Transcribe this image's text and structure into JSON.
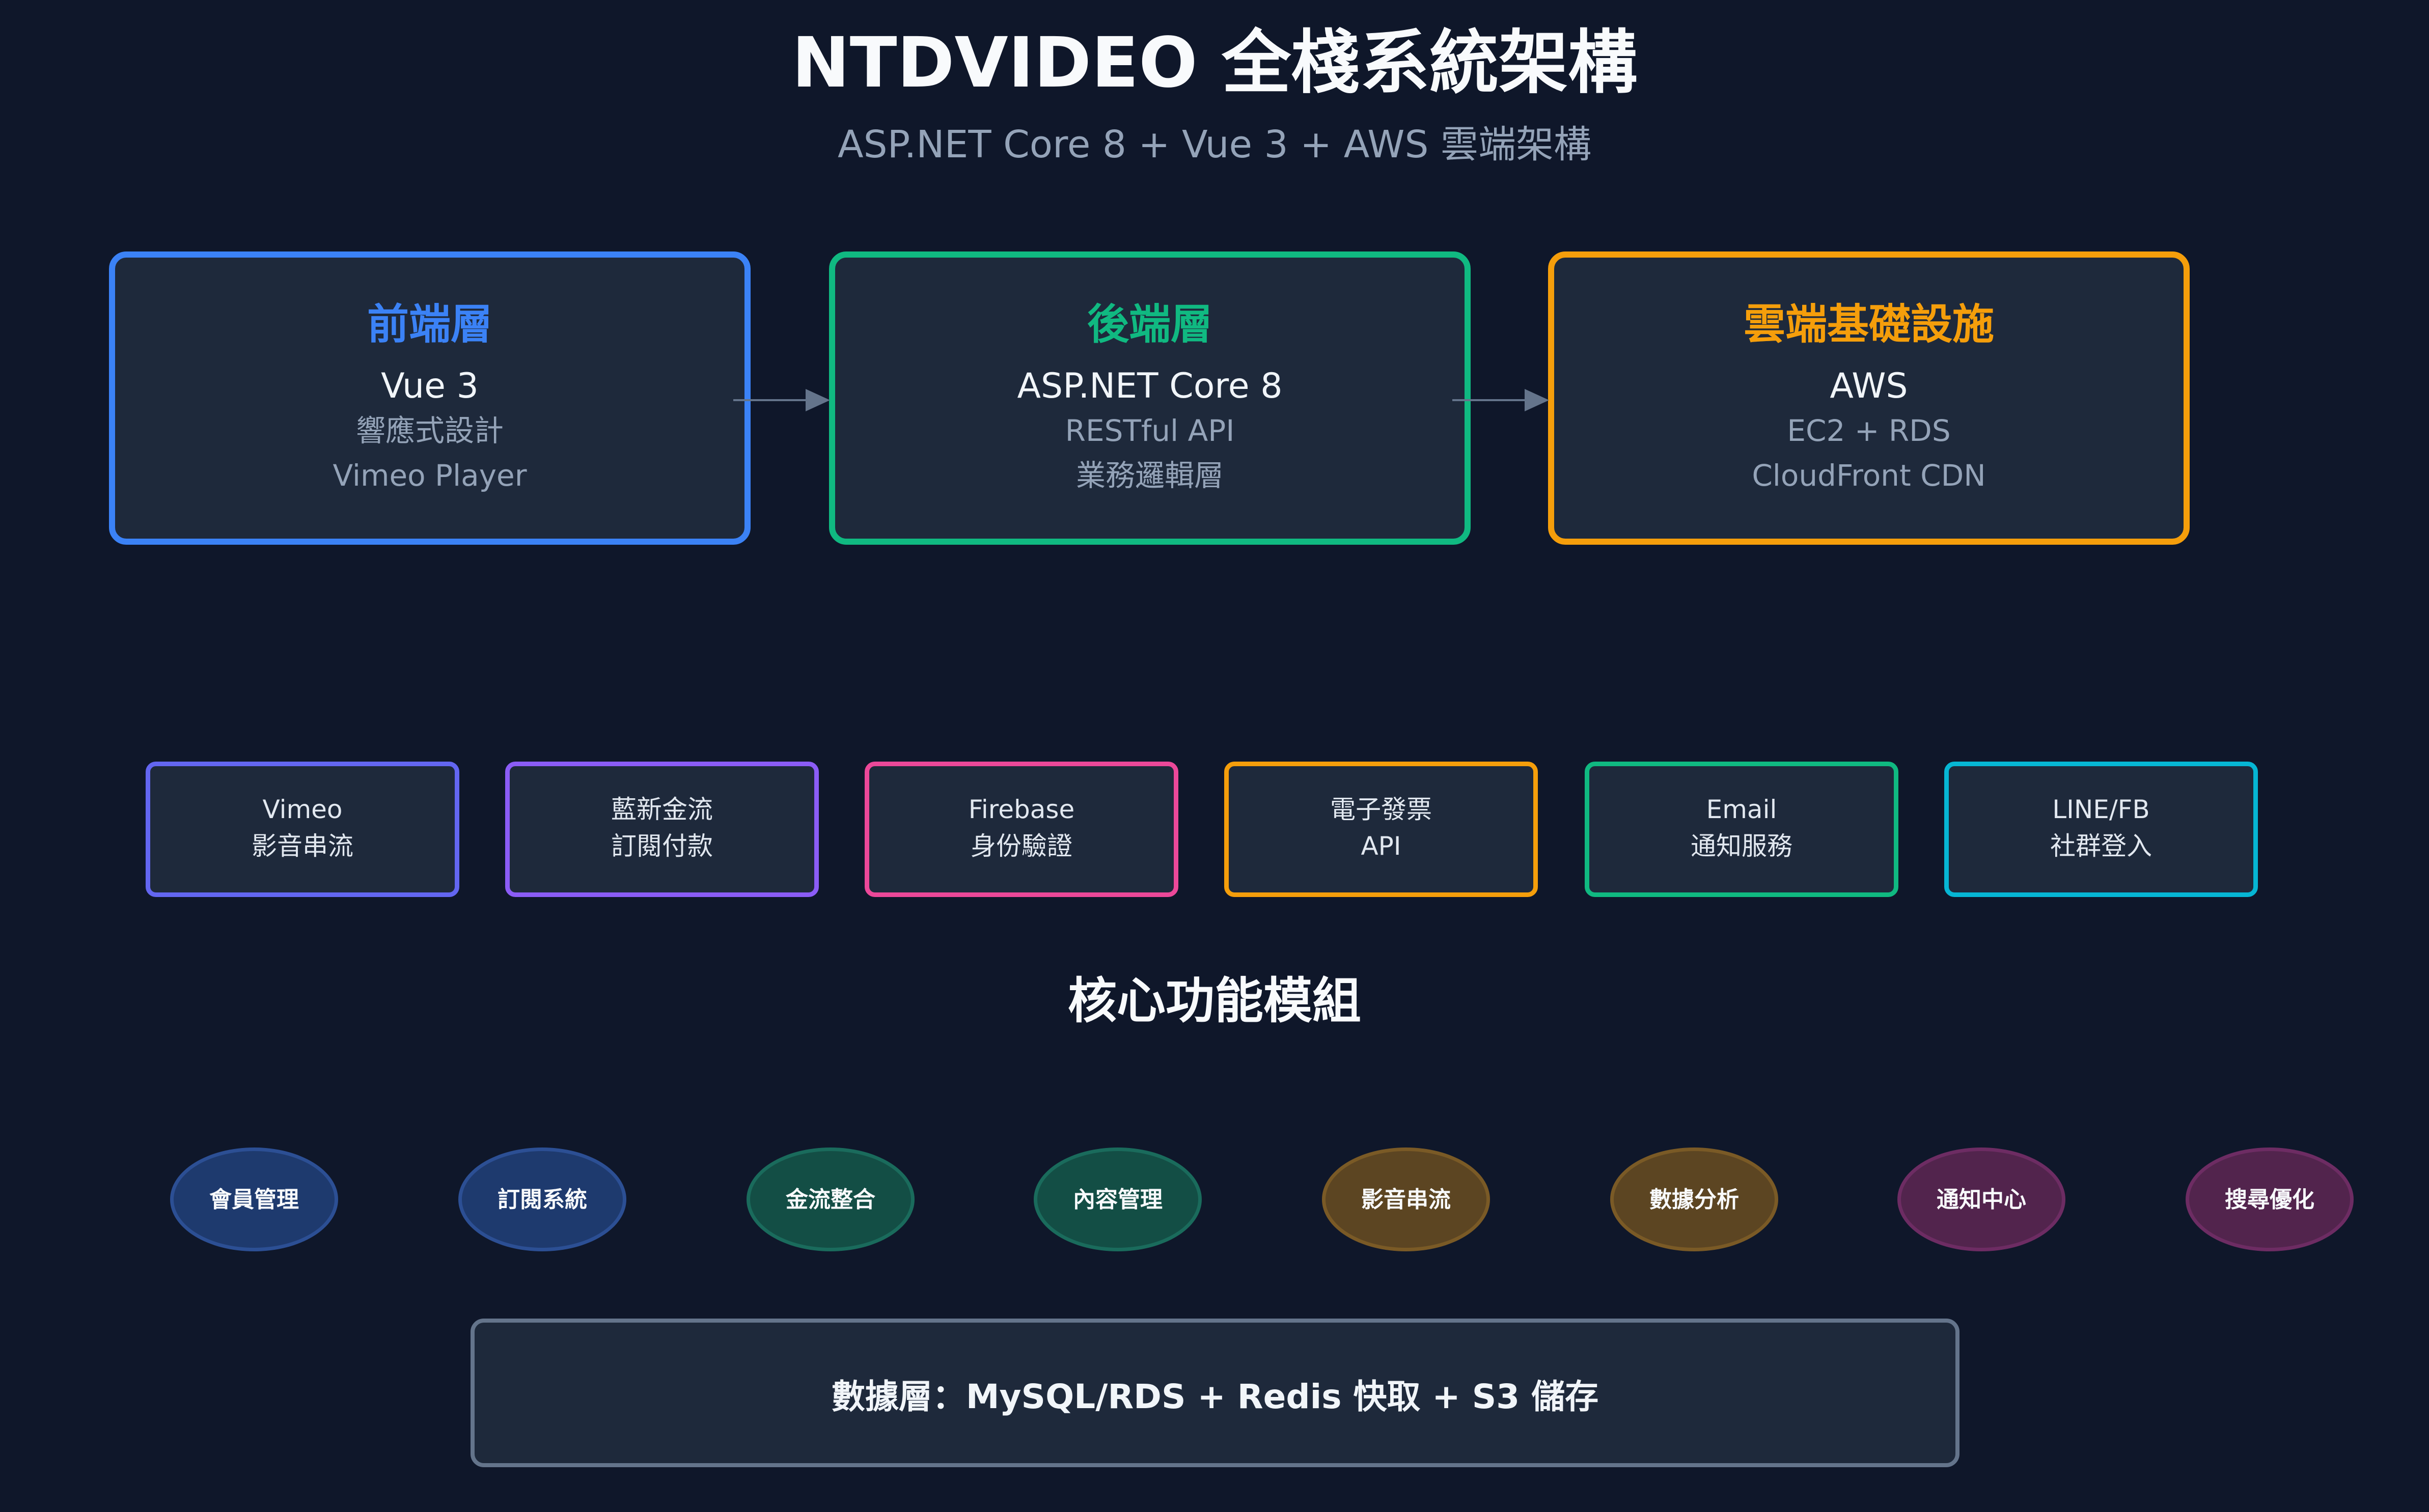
{
  "header": {
    "title": "NTDVIDEO 全棧系統架構",
    "subtitle": "ASP.NET Core 8 + Vue 3 + AWS 雲端架構"
  },
  "layers": [
    {
      "title": "前端層",
      "main": "Vue 3",
      "lines": [
        "響應式設計",
        "Vimeo Player"
      ],
      "color": "#3b82f6"
    },
    {
      "title": "後端層",
      "main": "ASP.NET Core 8",
      "lines": [
        "RESTful API",
        "業務邏輯層"
      ],
      "color": "#10b981"
    },
    {
      "title": "雲端基礎設施",
      "main": "AWS",
      "lines": [
        "EC2 + RDS",
        "CloudFront CDN"
      ],
      "color": "#f59e0b"
    }
  ],
  "arrow_color": "#64748b",
  "services": [
    {
      "lines": [
        "Vimeo",
        "影音串流"
      ],
      "color": "#6366f1"
    },
    {
      "lines": [
        "藍新金流",
        "訂閱付款"
      ],
      "color": "#8b5cf6"
    },
    {
      "lines": [
        "Firebase",
        "身份驗證"
      ],
      "color": "#ec4899"
    },
    {
      "lines": [
        "電子發票",
        "API"
      ],
      "color": "#f59e0b"
    },
    {
      "lines": [
        "Email",
        "通知服務"
      ],
      "color": "#10b981"
    },
    {
      "lines": [
        "LINE/FB",
        "社群登入"
      ],
      "color": "#06b6d4"
    }
  ],
  "core": {
    "heading": "核心功能模組",
    "modules": [
      {
        "label": "會員管理",
        "fill": "#1e3a6e",
        "stroke": "#2c4f94"
      },
      {
        "label": "訂閱系統",
        "fill": "#1e3a6e",
        "stroke": "#2c4f94"
      },
      {
        "label": "金流整合",
        "fill": "#134e45",
        "stroke": "#1a6b5c"
      },
      {
        "label": "內容管理",
        "fill": "#134e45",
        "stroke": "#1a6b5c"
      },
      {
        "label": "影音串流",
        "fill": "#5c4522",
        "stroke": "#7a5a26"
      },
      {
        "label": "數據分析",
        "fill": "#5c4522",
        "stroke": "#7a5a26"
      },
      {
        "label": "通知中心",
        "fill": "#52244d",
        "stroke": "#6d2c63"
      },
      {
        "label": "搜尋優化",
        "fill": "#52244d",
        "stroke": "#6d2c63"
      }
    ]
  },
  "data_layer": {
    "label": "數據層：MySQL/RDS + Redis 快取 + S3 儲存"
  }
}
